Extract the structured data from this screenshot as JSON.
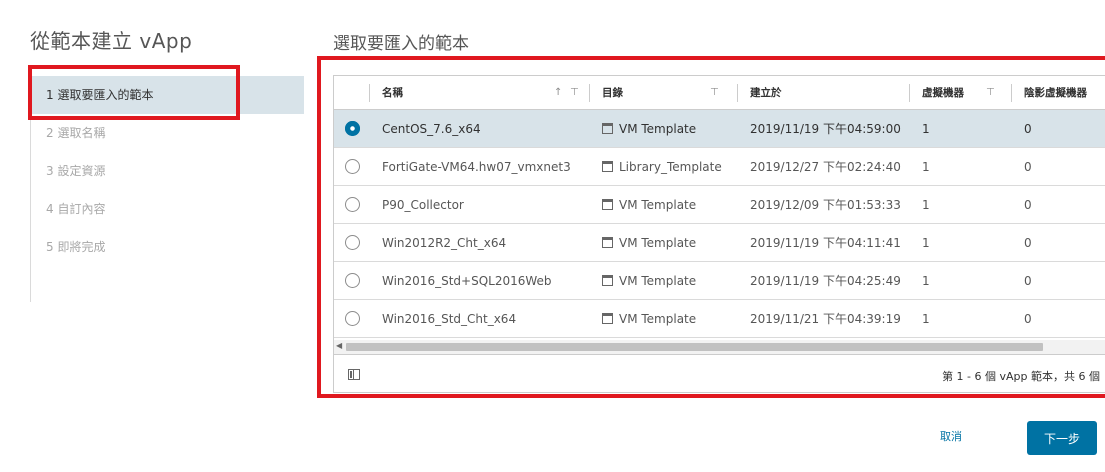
{
  "wizard": {
    "title": "從範本建立 vApp",
    "steps": [
      {
        "label": "1 選取要匯入的範本"
      },
      {
        "label": "2 選取名稱"
      },
      {
        "label": "3 設定資源"
      },
      {
        "label": "4 自訂內容"
      },
      {
        "label": "5 即將完成"
      }
    ],
    "active_step": 0
  },
  "main": {
    "title": "選取要匯入的範本",
    "columns": {
      "name": "名稱",
      "catalog": "目錄",
      "created": "建立於",
      "vms": "虛擬機器",
      "shadow_vms": "陰影虛擬機器"
    },
    "rows": [
      {
        "name": "CentOS_7.6_x64",
        "catalog": "VM Template",
        "created": "2019/11/19 下午04:59:00",
        "vms": "1",
        "shadow_vms": "0",
        "selected": true
      },
      {
        "name": "FortiGate-VM64.hw07_vmxnet3",
        "catalog": "Library_Template",
        "created": "2019/12/27 下午02:24:40",
        "vms": "1",
        "shadow_vms": "0",
        "selected": false
      },
      {
        "name": "P90_Collector",
        "catalog": "VM Template",
        "created": "2019/12/09 下午01:53:33",
        "vms": "1",
        "shadow_vms": "0",
        "selected": false
      },
      {
        "name": "Win2012R2_Cht_x64",
        "catalog": "VM Template",
        "created": "2019/11/19 下午04:11:41",
        "vms": "1",
        "shadow_vms": "0",
        "selected": false
      },
      {
        "name": "Win2016_Std+SQL2016Web",
        "catalog": "VM Template",
        "created": "2019/11/19 下午04:25:49",
        "vms": "1",
        "shadow_vms": "0",
        "selected": false
      },
      {
        "name": "Win2016_Std_Cht_x64",
        "catalog": "VM Template",
        "created": "2019/11/21 下午04:39:19",
        "vms": "1",
        "shadow_vms": "0",
        "selected": false
      }
    ],
    "pagination": "第 1 - 6 個 vApp 範本，共 6 個"
  },
  "buttons": {
    "cancel": "取消",
    "next": "下一步"
  },
  "colors": {
    "accent": "#0072a3",
    "highlight": "#e0181f",
    "selected_row": "#d8e3e9"
  },
  "icons": {
    "sort": "sort-ascending-icon",
    "filter": "filter-icon",
    "template": "template-icon",
    "column_toggle": "column-toggle-icon"
  }
}
